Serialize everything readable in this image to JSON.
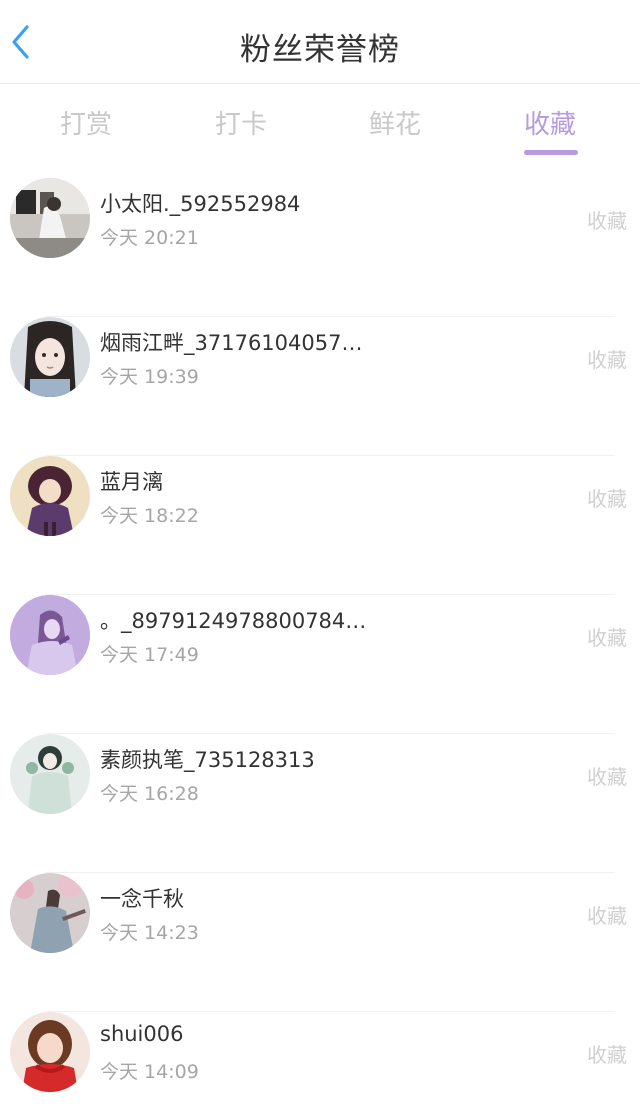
{
  "header": {
    "title": "粉丝荣誉榜",
    "back_icon": "chevron-left-icon",
    "accent_color": "#3aa0f0"
  },
  "tabs": [
    {
      "label": "打赏",
      "active": false
    },
    {
      "label": "打卡",
      "active": false
    },
    {
      "label": "鲜花",
      "active": false
    },
    {
      "label": "收藏",
      "active": true
    }
  ],
  "colors": {
    "active_tab": "#b79be2",
    "inactive_tab": "#c9c9c9",
    "name_text": "#333333",
    "time_text": "#a6a6a6",
    "action_text": "#d0d0d0"
  },
  "fans": [
    {
      "name": "小太阳._592552984",
      "time": "今天 20:21",
      "action": "收藏"
    },
    {
      "name": "烟雨江畔_37176104057…",
      "time": "今天 19:39",
      "action": "收藏"
    },
    {
      "name": "蓝月漓",
      "time": "今天 18:22",
      "action": "收藏"
    },
    {
      "name": "。_8979124978800784…",
      "time": "今天 17:49",
      "action": "收藏"
    },
    {
      "name": "素颜执笔_735128313",
      "time": "今天 16:28",
      "action": "收藏"
    },
    {
      "name": "一念千秋",
      "time": "今天 14:23",
      "action": "收藏"
    },
    {
      "name": "shui006",
      "time": "今天 14:09",
      "action": "收藏"
    }
  ]
}
